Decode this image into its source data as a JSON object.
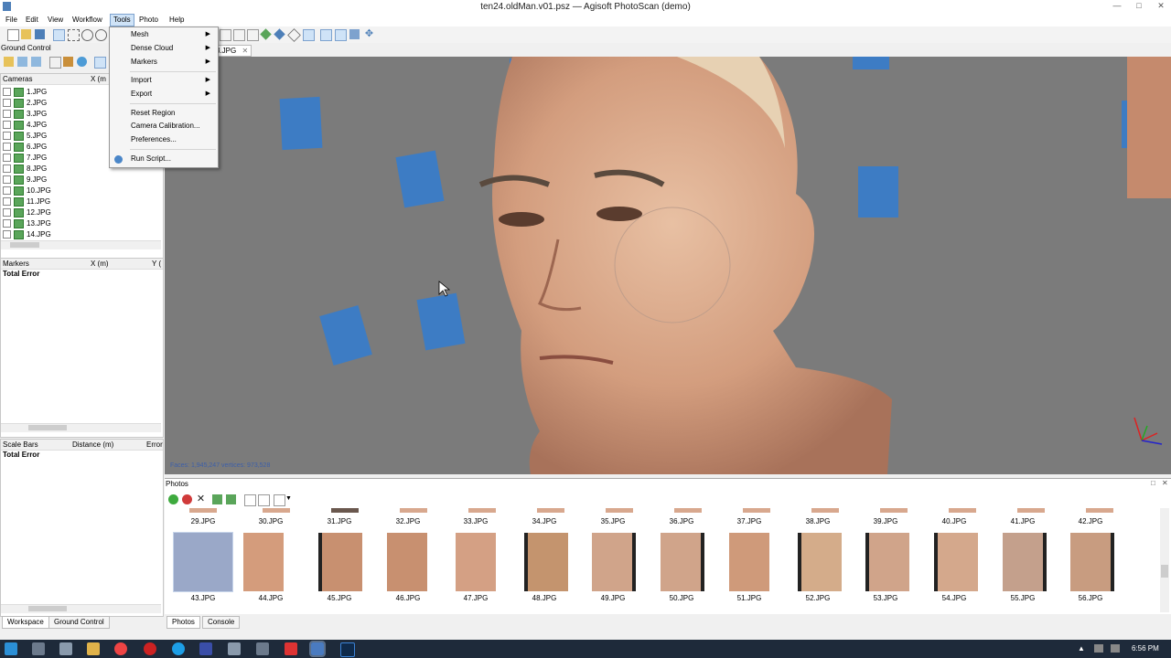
{
  "window": {
    "title": "ten24.oldMan.v01.psz — Agisoft PhotoScan (demo)",
    "icons": [
      "minimize-icon",
      "maximize-icon",
      "close-icon"
    ]
  },
  "menu": {
    "items": [
      "File",
      "Edit",
      "View",
      "Workflow",
      "Tools",
      "Photo",
      "Help"
    ]
  },
  "tools_menu": {
    "items": [
      {
        "label": "Mesh",
        "submenu": true
      },
      {
        "label": "Dense Cloud",
        "submenu": true
      },
      {
        "label": "Markers",
        "submenu": true
      },
      {
        "label": "Import",
        "submenu": true
      },
      {
        "label": "Export",
        "submenu": true
      },
      {
        "label": "Reset Region",
        "submenu": false
      },
      {
        "label": "Camera Calibration...",
        "submenu": false
      },
      {
        "label": "Preferences...",
        "submenu": false
      },
      {
        "label": "Run Script...",
        "submenu": false
      }
    ]
  },
  "ground_control": {
    "title": "Ground Control",
    "cameras_header": {
      "col1": "Cameras",
      "col2": "X (m"
    },
    "cameras": [
      "1.JPG",
      "2.JPG",
      "3.JPG",
      "4.JPG",
      "5.JPG",
      "6.JPG",
      "7.JPG",
      "8.JPG",
      "9.JPG",
      "10.JPG",
      "11.JPG",
      "12.JPG",
      "13.JPG",
      "14.JPG"
    ],
    "markers_header": {
      "col1": "Markers",
      "col2": "X (m)",
      "col3": "Y ("
    },
    "markers_total": "Total Error",
    "scalebars_header": {
      "col1": "Scale Bars",
      "col2": "Distance (m)",
      "col3": "Error"
    },
    "scalebars_total": "Total Error"
  },
  "viewport": {
    "tab_label": "3.JPG",
    "stats": "Faces: 1,945,247 vertices: 973,528"
  },
  "photos": {
    "title": "Photos",
    "row1": [
      "29.JPG",
      "30.JPG",
      "31.JPG",
      "32.JPG",
      "33.JPG",
      "34.JPG",
      "35.JPG",
      "36.JPG",
      "37.JPG",
      "38.JPG",
      "39.JPG",
      "40.JPG",
      "41.JPG",
      "42.JPG"
    ],
    "row2": [
      "43.JPG",
      "44.JPG",
      "45.JPG",
      "46.JPG",
      "47.JPG",
      "48.JPG",
      "49.JPG",
      "50.JPG",
      "51.JPG",
      "52.JPG",
      "53.JPG",
      "54.JPG",
      "55.JPG",
      "56.JPG"
    ],
    "tabs": [
      "Photos",
      "Console"
    ]
  },
  "left_tabs": [
    "Workspace",
    "Ground Control"
  ],
  "taskbar": {
    "time": "6:56 PM"
  },
  "colors": {
    "camera_blue": "#3d7cc4",
    "viewport_bg": "#7b7b7b",
    "taskbar": "#1e2a3a",
    "menu_highlight": "#cfe3f7"
  }
}
